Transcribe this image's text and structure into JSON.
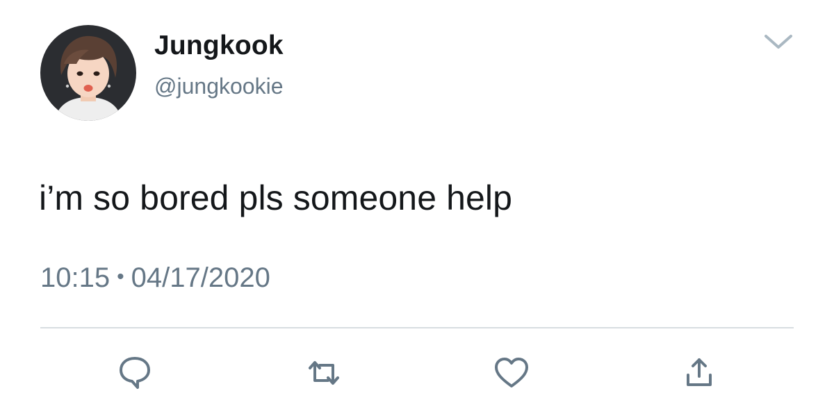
{
  "tweet": {
    "display_name": "Jungkook",
    "handle": "@jungkookie",
    "text": "i’m so bored pls someone help",
    "time": "10:15",
    "separator": "•",
    "date": "04/17/2020"
  },
  "icons": {
    "caret": "chevron-down-icon",
    "reply": "reply-bubble-icon",
    "retweet": "retweet-icon",
    "like": "heart-icon",
    "share": "share-upload-icon"
  },
  "colors": {
    "text_primary": "#14171a",
    "text_secondary": "#657786",
    "icon_gray": "#657786",
    "caret_gray": "#aab8c2",
    "divider": "#d8dde1"
  }
}
